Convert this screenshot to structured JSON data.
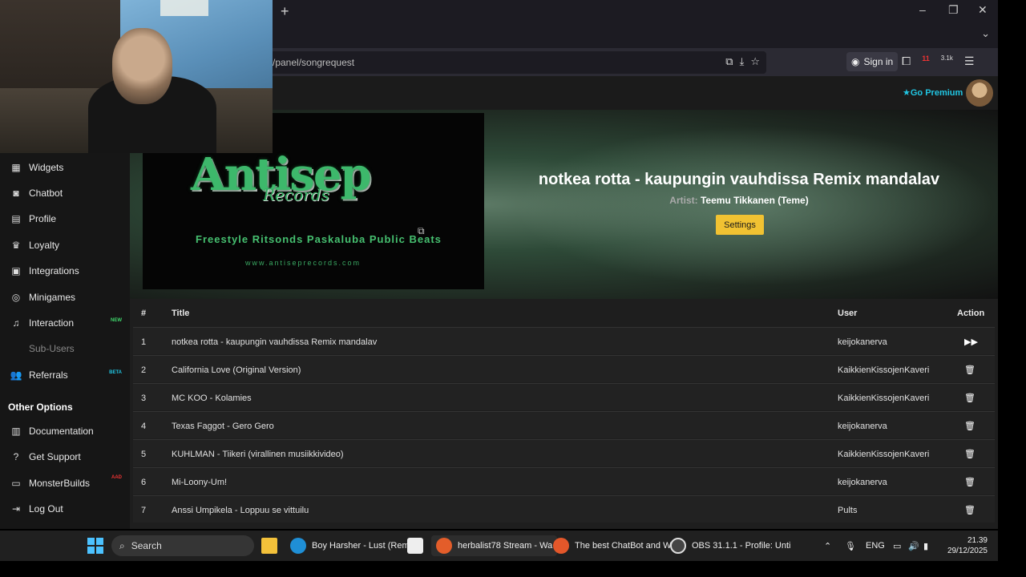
{
  "browser": {
    "new_tab_glyph": "+",
    "window_controls": [
      "–",
      "❐",
      "✕"
    ],
    "url": "/panel/songrequest",
    "sign_in": "Sign in",
    "notif_badge_1": "11",
    "notif_badge_2": "3.1k"
  },
  "header": {
    "go_premium": "Go Premium",
    "accent": "#21c6e3"
  },
  "sidebar": {
    "items": [
      {
        "label": "Widgets",
        "icon": "grid-icon"
      },
      {
        "label": "Chatbot",
        "icon": "robot-icon"
      },
      {
        "label": "Profile",
        "icon": "id-card-icon"
      },
      {
        "label": "Loyalty",
        "icon": "trophy-icon"
      },
      {
        "label": "Integrations",
        "icon": "plug-icon"
      },
      {
        "label": "Minigames",
        "icon": "gamepad-icon"
      },
      {
        "label": "Interaction",
        "icon": "music-note-icon",
        "badge": "NEW"
      },
      {
        "label": "Sub-Users",
        "icon": "people-icon"
      },
      {
        "label": "Referrals",
        "icon": "users-icon",
        "badge": "BETA"
      }
    ],
    "other_title": "Other Options",
    "other_items": [
      {
        "label": "Documentation",
        "icon": "book-icon"
      },
      {
        "label": "Get Support",
        "icon": "question-icon"
      },
      {
        "label": "MonsterBuilds",
        "icon": "monitor-icon",
        "badge": "AAD"
      },
      {
        "label": "Log Out",
        "icon": "logout-icon"
      }
    ]
  },
  "hero": {
    "logo_main": "Antisep",
    "logo_sub": "Records",
    "logo_tagline": "Freestyle Ritsonds Paskaluba Public Beats",
    "logo_url": "www.antiseprecords.com",
    "song_title": "notkea rotta - kaupungin vauhdissa Remix mandalav",
    "artist_label": "Artist:",
    "artist_name": "Teemu Tikkanen (Teme)",
    "settings_label": "Settings"
  },
  "table": {
    "headers": {
      "num": "#",
      "title": "Title",
      "user": "User",
      "action": "Action"
    },
    "rows": [
      {
        "num": "1",
        "title": "notkea rotta - kaupungin vauhdissa Remix mandalav",
        "user": "keijokanerva",
        "action": "▶▶"
      },
      {
        "num": "2",
        "title": "California Love (Original Version)",
        "user": "KaikkienKissojenKaveri",
        "action": "🗑"
      },
      {
        "num": "3",
        "title": "MC KOO - Kolamies",
        "user": "KaikkienKissojenKaveri",
        "action": "🗑"
      },
      {
        "num": "4",
        "title": "Texas Faggot - Gero Gero",
        "user": "keijokanerva",
        "action": "🗑"
      },
      {
        "num": "5",
        "title": "KUHLMAN - Tiikeri (virallinen musiikkivideo)",
        "user": "KaikkienKissojenKaveri",
        "action": "🗑"
      },
      {
        "num": "6",
        "title": "Mi-Loony-Um!",
        "user": "keijokanerva",
        "action": "🗑"
      },
      {
        "num": "7",
        "title": "Anssi Umpikela - Loppuu se vittuilu",
        "user": "Pults",
        "action": "🗑"
      }
    ]
  },
  "taskbar": {
    "search": "Search",
    "apps": [
      {
        "label": "Boy Harsher - Lust (Rem",
        "color": "#1f8fd6"
      },
      {
        "label": "herbalist78 Stream - Wa",
        "color": "#e35d2a"
      },
      {
        "label": "The best ChatBot and W",
        "color": "#e3572a"
      },
      {
        "label": "OBS 31.1.1 - Profile: Unti",
        "color": "#444444"
      }
    ],
    "lang": "ENG",
    "time": "21.39",
    "date": "29/12/2025"
  }
}
